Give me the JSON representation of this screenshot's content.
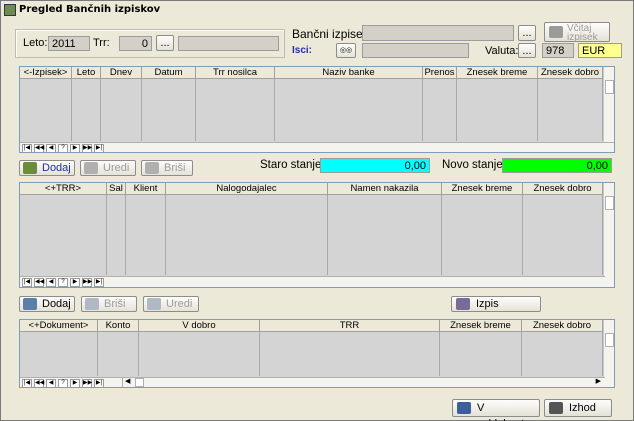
{
  "window": {
    "title": "Pregled Bančnih izpiskov"
  },
  "header": {
    "leto_label": "Leto:",
    "leto_value": "2011",
    "trr_label": "Trr:",
    "trr_value": "0",
    "trr_button": "...",
    "bancni_label": "Bančni izpisek:",
    "bancni_button": "...",
    "vcitaj_label": "Včitaj izpisek",
    "isci_label": "Isci:",
    "valuta_label": "Valuta:",
    "valuta_button": "...",
    "valuta_code": "978",
    "valuta_name": "EUR"
  },
  "grid1": {
    "columns": [
      "<-Izpisek>",
      "Leto",
      "Dnev",
      "Datum",
      "Trr nosilca",
      "Naziv banke",
      "Prenos",
      "Znesek breme",
      "Znesek dobro"
    ]
  },
  "actions1": {
    "dodaj": "Dodaj",
    "uredi": "Uredi",
    "brisi": "Briši",
    "staro_label": "Staro stanje:",
    "staro_value": "0,00",
    "novo_label": "Novo stanje:",
    "novo_value": "0,00",
    "staro_color": "#00ffff",
    "novo_color": "#00ff00"
  },
  "grid2": {
    "columns": [
      "<+TRR>",
      "Sal",
      "Klient",
      "Nalogodajalec",
      "Namen nakazila",
      "Znesek breme",
      "Znesek dobro"
    ]
  },
  "actions2": {
    "dodaj": "Dodaj",
    "brisi": "Briši",
    "uredi": "Uredi",
    "izpis": "Izpis"
  },
  "grid3": {
    "columns": [
      "<+Dokument>",
      "Konto",
      "V dobro",
      "TRR",
      "Znesek breme",
      "Znesek dobro"
    ]
  },
  "nav_buttons": [
    "|◀",
    "◀◀",
    "◀",
    "?",
    "▶",
    "▶▶",
    "▶|"
  ],
  "footer": {
    "saldakonte": "V saldakonte",
    "izhod": "Izhod"
  }
}
